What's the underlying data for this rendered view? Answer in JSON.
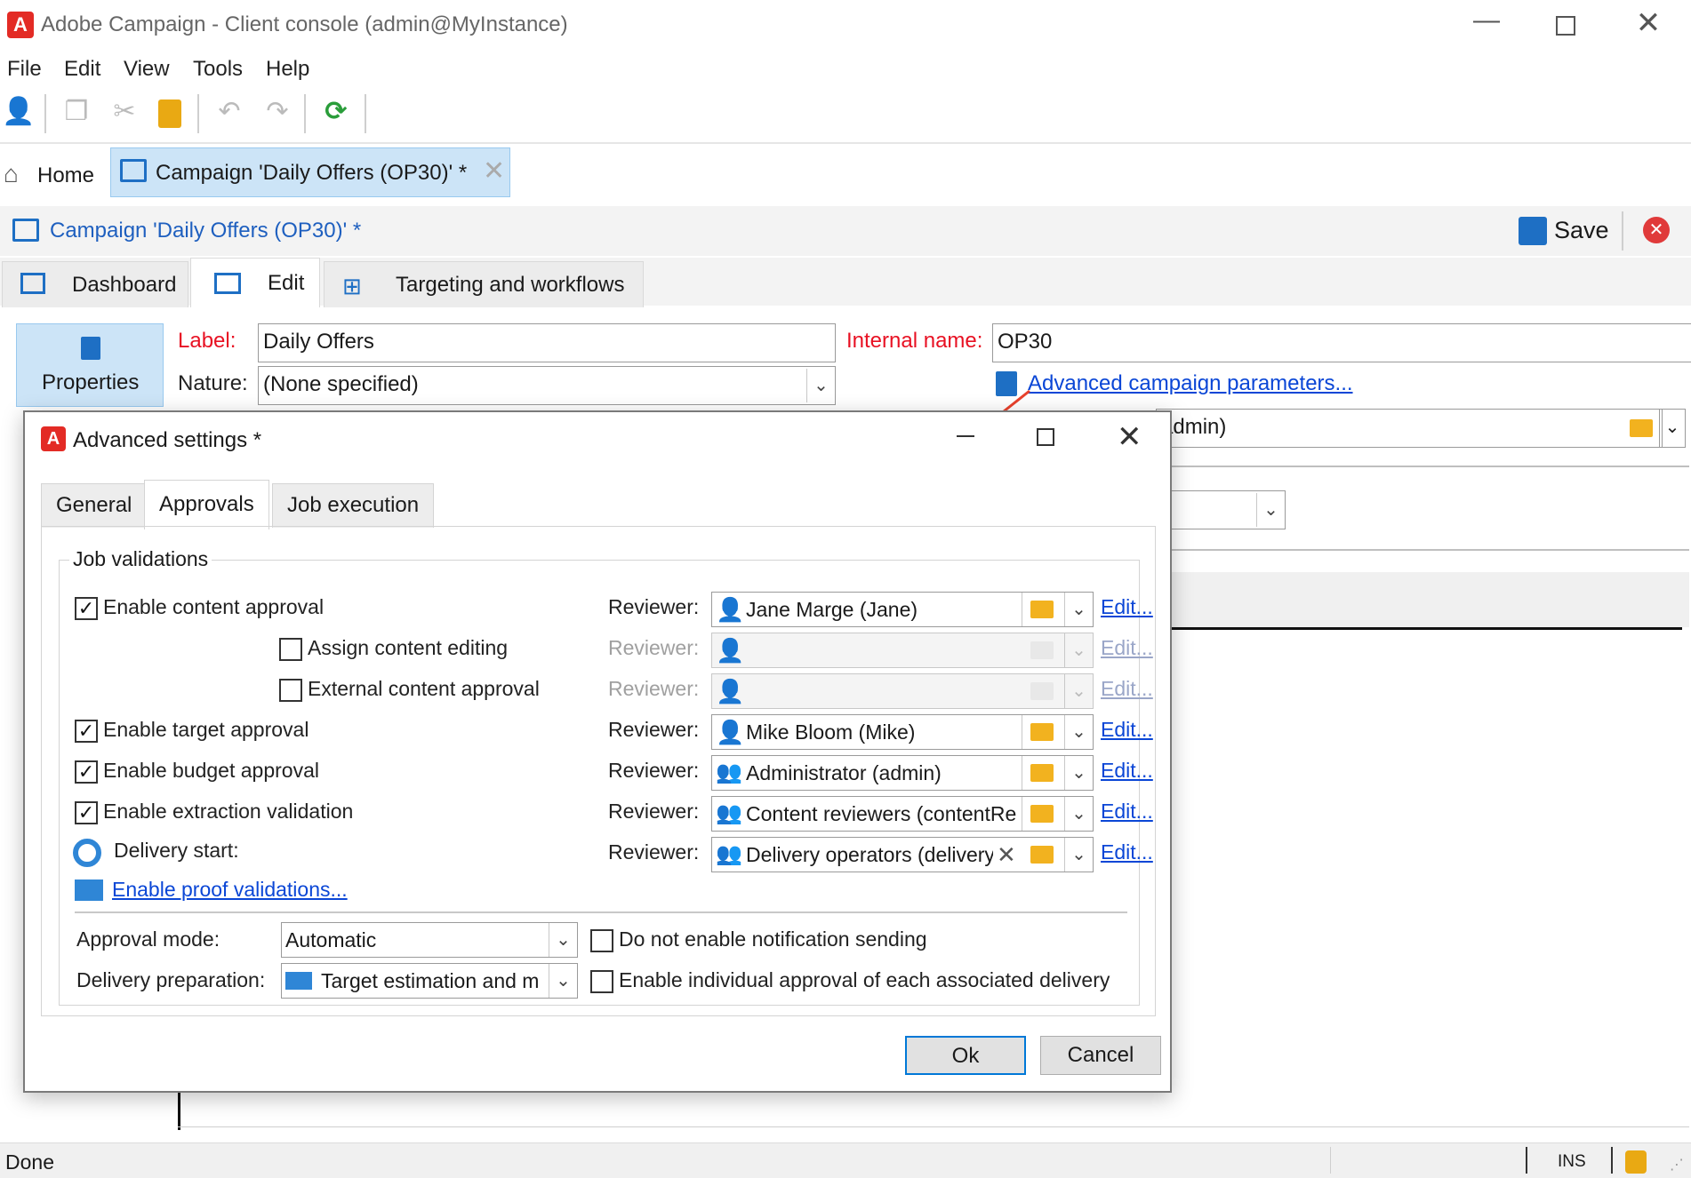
{
  "window": {
    "title": "Adobe Campaign - Client console (admin@MyInstance)",
    "logo_letter": "A"
  },
  "menu": [
    "File",
    "Edit",
    "View",
    "Tools",
    "Help"
  ],
  "tabs": {
    "home": "Home",
    "campaign": "Campaign 'Daily Offers (OP30)' *"
  },
  "campaign_header": {
    "title": "Campaign 'Daily Offers (OP30)' *",
    "save_label": "Save"
  },
  "sub_tabs": [
    "Dashboard",
    "Edit",
    "Targeting and workflows"
  ],
  "form": {
    "properties_label": "Properties",
    "label_label": "Label:",
    "label_value": "Daily Offers",
    "internal_name_label": "Internal name:",
    "internal_name_value": "OP30",
    "nature_label": "Nature:",
    "nature_value": "(None specified)",
    "advanced_link": "Advanced campaign parameters...",
    "manager_value_fragment": "admin)"
  },
  "dialog": {
    "title": "Advanced settings *",
    "tabs": [
      "General",
      "Approvals",
      "Job execution"
    ],
    "active_tab": "Approvals",
    "group_title": "Job validations",
    "reviewer_label": "Reviewer:",
    "edit_label": "Edit...",
    "rows": [
      {
        "label": "Enable content approval",
        "checked": true,
        "indent": false,
        "reviewer": "Jane Marge (Jane)",
        "enabled": true,
        "reviewer_type": "user"
      },
      {
        "label": "Assign content editing",
        "checked": false,
        "indent": true,
        "reviewer": "",
        "enabled": false,
        "reviewer_type": "user"
      },
      {
        "label": "External content approval",
        "checked": false,
        "indent": true,
        "reviewer": "",
        "enabled": false,
        "reviewer_type": "user"
      },
      {
        "label": "Enable target approval",
        "checked": true,
        "indent": false,
        "reviewer": "Mike Bloom (Mike)",
        "enabled": true,
        "reviewer_type": "user"
      },
      {
        "label": "Enable budget approval",
        "checked": true,
        "indent": false,
        "reviewer": "Administrator (admin)",
        "enabled": true,
        "reviewer_type": "group"
      },
      {
        "label": "Enable extraction validation",
        "checked": true,
        "indent": false,
        "reviewer": "Content reviewers (contentRe",
        "enabled": true,
        "reviewer_type": "group"
      },
      {
        "label": "Delivery start:",
        "checked": null,
        "indent": false,
        "reviewer": "Delivery operators (delivery",
        "enabled": true,
        "reviewer_type": "group",
        "clear": true
      }
    ],
    "proof_link": "Enable proof validations...",
    "approval_mode_label": "Approval mode:",
    "approval_mode_value": "Automatic",
    "delivery_prep_label": "Delivery preparation:",
    "delivery_prep_value": "Target estimation and m",
    "notify_checkbox": "Do not enable notification sending",
    "individual_checkbox": "Enable individual approval of each associated delivery",
    "ok": "Ok",
    "cancel": "Cancel"
  },
  "status": {
    "left": "Done",
    "ins": "INS"
  },
  "colors": {
    "brand_red": "#e32b25",
    "link_blue": "#0a46d6",
    "label_red": "#e81123",
    "active_tab_blue": "#cce4f7",
    "arrow_red": "#e8412c"
  }
}
